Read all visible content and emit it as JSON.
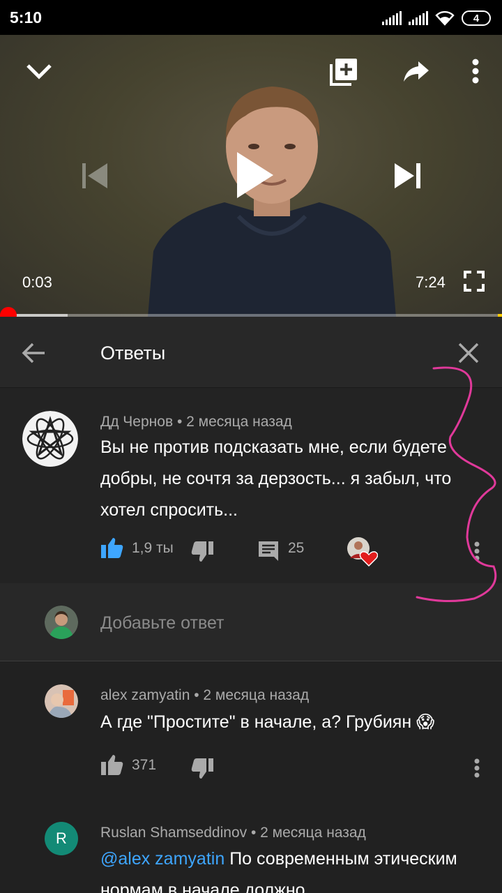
{
  "status_bar": {
    "time": "5:10",
    "battery": "4"
  },
  "video": {
    "current_time": "0:03",
    "duration": "7:24",
    "progress": 0.007
  },
  "replies_panel": {
    "title": "Ответы",
    "main_comment": {
      "author": "Дд Чернов",
      "age": "2 месяца назад",
      "text": "Вы не против подсказать мне, если будете добры, не сочтя за дерзость... я забыл, что хотел спросить...",
      "likes": "1,9 ты",
      "replies": "25"
    },
    "reply_input": {
      "placeholder": "Добавьте ответ"
    },
    "replies": [
      {
        "author": "alex zamyatin",
        "age": "2 месяца назад",
        "text": "А где \"Простите\" в начале, а? Грубиян 😱",
        "likes": "371"
      },
      {
        "author": "Ruslan Shamseddinov",
        "age": "2 месяца назад",
        "avatar_letter": "R",
        "mention": "@alex zamyatin",
        "text": "По современным этическим нормам в начале должно"
      }
    ]
  },
  "colors": {
    "accent_blue": "#3ea6ff",
    "progress_red": "#ff0000",
    "annotation_pink": "#e0399a"
  }
}
